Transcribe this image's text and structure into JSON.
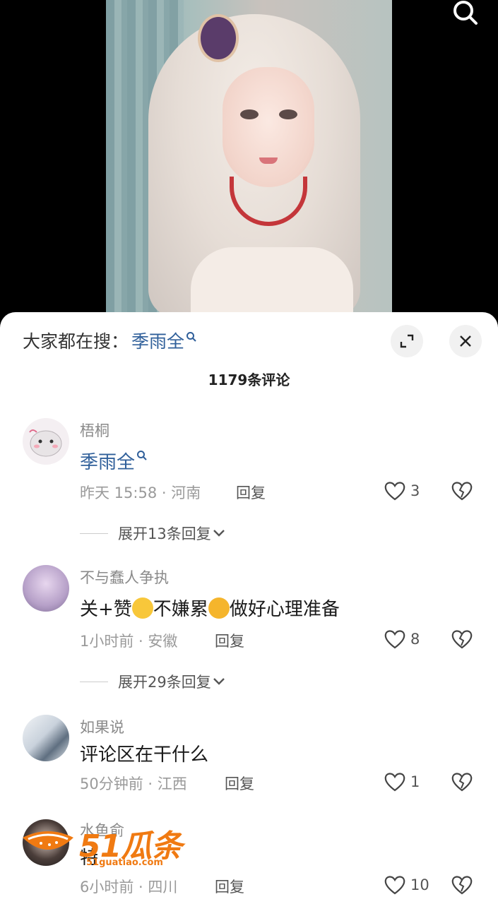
{
  "hot_search": {
    "label": "大家都在搜：",
    "term": "季雨全"
  },
  "comments_header": {
    "count_title": "1179条评论"
  },
  "comments": [
    {
      "username": "梧桐",
      "text": "季雨全",
      "time": "昨天 15:58",
      "location": "河南",
      "reply_label": "回复",
      "likes": "3",
      "expand_label": "展开13条回复"
    },
    {
      "username": "不与蠢人争执",
      "text_part1": "关+赞",
      "emoji1": "laughing-crying-emoji",
      "text_part2": "不嫌累",
      "emoji2": "crying-emoji",
      "text_part3": "做好心理准备",
      "time": "1小时前",
      "location": "安徽",
      "reply_label": "回复",
      "likes": "8",
      "expand_label": "展开29条回复"
    },
    {
      "username": "如果说",
      "text": "评论区在干什么",
      "time": "50分钟前",
      "location": "江西",
      "reply_label": "回复",
      "likes": "1"
    },
    {
      "username": "水鱼俞",
      "text": "特",
      "time": "6小时前",
      "location": "四川",
      "reply_label": "回复",
      "likes": "10"
    }
  ],
  "watermark": {
    "logo": "51瓜条",
    "url": "51guatiao.com"
  },
  "colors": {
    "link_blue": "#2f5f9a",
    "watermark_orange": "#f07a12"
  }
}
